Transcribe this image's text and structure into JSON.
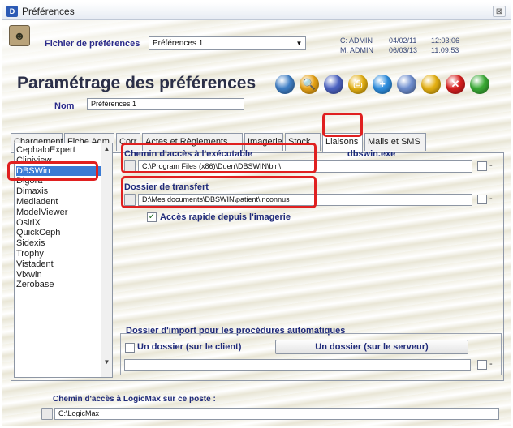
{
  "window": {
    "title": "Préférences",
    "app_icon_glyph": "D",
    "close_glyph": "⊠"
  },
  "header": {
    "prefs_file_label": "Fichier de préférences",
    "prefs_file_value": "Préférences 1",
    "created_by": "C: ADMIN",
    "modified_by": "M: ADMIN",
    "created_date": "04/02/11",
    "modified_date": "06/03/13",
    "created_time": "12:03:06",
    "modified_time": "11:09:53",
    "page_title": "Paramétrage des préférences",
    "name_label": "Nom",
    "name_value": "Préférences 1"
  },
  "toolbar": {
    "icons": [
      {
        "name": "globe-icon",
        "color": "#3f7fc6",
        "glyph": ""
      },
      {
        "name": "search-icon",
        "color": "#e8a316",
        "glyph": "🔍"
      },
      {
        "name": "chart-icon",
        "color": "#4c63c2",
        "glyph": ""
      },
      {
        "name": "print-icon",
        "color": "#e6b112",
        "glyph": "⎙"
      },
      {
        "name": "add-icon",
        "color": "#2f8fe0",
        "glyph": "+"
      },
      {
        "name": "link-icon",
        "color": "#6f8fd0",
        "glyph": ""
      },
      {
        "name": "trash-icon",
        "color": "#e6b112",
        "glyph": ""
      },
      {
        "name": "cancel-icon",
        "color": "#d91f1f",
        "glyph": "✕"
      },
      {
        "name": "validate-icon",
        "color": "#3aab35",
        "glyph": ""
      }
    ]
  },
  "tabs": [
    "Chargement",
    "Fiche Adm.",
    "Corr.",
    "Actes et Règlements",
    "Imagerie",
    "Stock",
    "Liaisons",
    "Mails et SMS"
  ],
  "active_tab": "Liaisons",
  "software_list": [
    "CephaloExpert",
    "Cliniview",
    "DBSWin",
    "Digora",
    "Dimaxis",
    "Mediadent",
    "ModelViewer",
    "OsiriX",
    "QuickCeph",
    "Sidexis",
    "Trophy",
    "Vistadent",
    "Vixwin",
    "Zerobase"
  ],
  "selected_software": "DBSWin",
  "liaison": {
    "exe_path_label": "Chemin d'accès à l'exécutable",
    "exe_name": "dbswin.exe",
    "exe_path_value": "C:\\Program Files (x86)\\Duerr\\DBSWIN\\bin\\",
    "transfer_folder_label": "Dossier de transfert",
    "transfer_folder_value": "D:\\Mes documents\\DBSWIN\\patient\\inconnus",
    "quick_access_label": "Accès rapide depuis l'imagerie",
    "quick_access_checked": "✓"
  },
  "import": {
    "section_label": "Dossier d'import pour les procédures automatiques",
    "client_folder_label": "Un dossier (sur le client)",
    "server_folder_label": "Un dossier (sur le serveur)",
    "path_value": ""
  },
  "logicmax": {
    "label": "Chemin d'accès à LogicMax sur ce poste :",
    "path_value": "C:\\LogicMax"
  }
}
